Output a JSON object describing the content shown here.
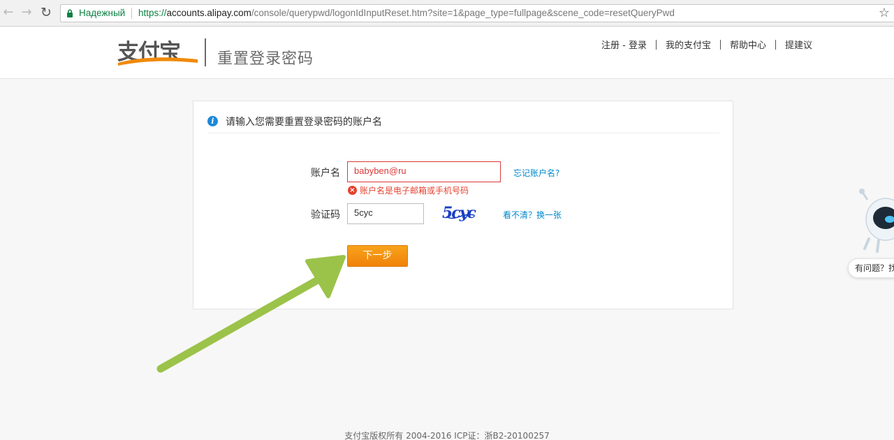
{
  "browser": {
    "secure_label": "Надежный",
    "url_scheme": "https://",
    "url_host": "accounts.alipay.com",
    "url_path": "/console/querypwd/logonIdInputReset.htm?site=1&page_type=fullpage&scene_code=resetQueryPwd",
    "icons": [
      "back-arrow-icon",
      "forward-arrow-icon",
      "reload-icon",
      "lock-icon",
      "star-icon"
    ]
  },
  "header": {
    "logo_text": "支付宝",
    "page_title": "重置登录密码",
    "links": [
      "注册 - 登录",
      "我的支付宝",
      "帮助中心",
      "提建议"
    ]
  },
  "form": {
    "title": "请输入您需要重置登录密码的账户名",
    "account_label": "账户名",
    "account_value": "babyben@ru",
    "forgot_link": "忘记账户名?",
    "error_text": "账户名是电子邮箱或手机号码",
    "captcha_label": "验证码",
    "captcha_value": "5cyc",
    "captcha_image_text": "5cyc",
    "refresh_link": "看不清？换一张",
    "submit_label": "下一步"
  },
  "helper": {
    "bubble_text": "有问题？找"
  },
  "footer": {
    "copyright": "支付宝版权所有 2004-2016 ICP证：浙B2-20100257"
  },
  "colors": {
    "brand_orange": "#f08a0b",
    "link_blue": "#0088cc",
    "error_red": "#e6422f",
    "annotation_arrow_green": "#9bc34a"
  }
}
